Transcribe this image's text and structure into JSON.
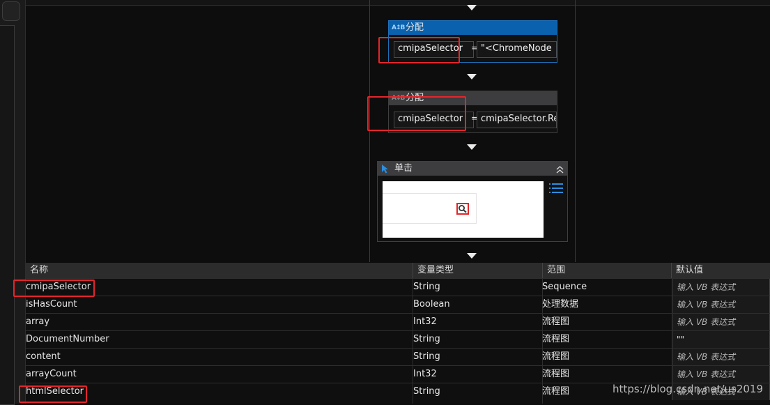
{
  "designer": {
    "assign1": {
      "title": "分配",
      "icon": "ab-assign-icon",
      "left_value": "cmipaSelector",
      "equals": "=",
      "right_value": "\"<ChromeNode"
    },
    "assign2": {
      "title": "分配",
      "icon": "ab-assign-icon",
      "left_value": "cmipaSelector",
      "equals": "=",
      "right_value": "cmipaSelector.Re"
    },
    "click": {
      "title": "单击",
      "icon": "cursor-pointer-icon",
      "collapse_icon": "chevron-up-icon",
      "menu_icon": "list-menu-icon",
      "preview_icon": "magnifier-icon"
    }
  },
  "variables": {
    "headers": [
      "名称",
      "变量类型",
      "范围",
      "默认值"
    ],
    "rows": [
      {
        "name": "cmipaSelector",
        "type": "String",
        "scope": "Sequence",
        "default": "输入 VB 表达式"
      },
      {
        "name": "isHasCount",
        "type": "Boolean",
        "scope": "处理数据",
        "default": "输入 VB 表达式"
      },
      {
        "name": "array",
        "type": "Int32",
        "scope": "流程图",
        "default": "输入 VB 表达式"
      },
      {
        "name": "DocumentNumber",
        "type": "String",
        "scope": "流程图",
        "default": "\"\""
      },
      {
        "name": "content",
        "type": "String",
        "scope": "流程图",
        "default": "输入 VB 表达式"
      },
      {
        "name": "arrayCount",
        "type": "Int32",
        "scope": "流程图",
        "default": "输入 VB 表达式"
      },
      {
        "name": "htmlSelector",
        "type": "String",
        "scope": "流程图",
        "default": "输入 VB 表达式"
      }
    ]
  },
  "watermark": "https://blog.csdn.net/us2019",
  "colors": {
    "selected_header": "#0a62ae",
    "activity_header": "#3d3d40",
    "highlight_box": "#e3262b",
    "accent_blue": "#2b8ee0"
  }
}
